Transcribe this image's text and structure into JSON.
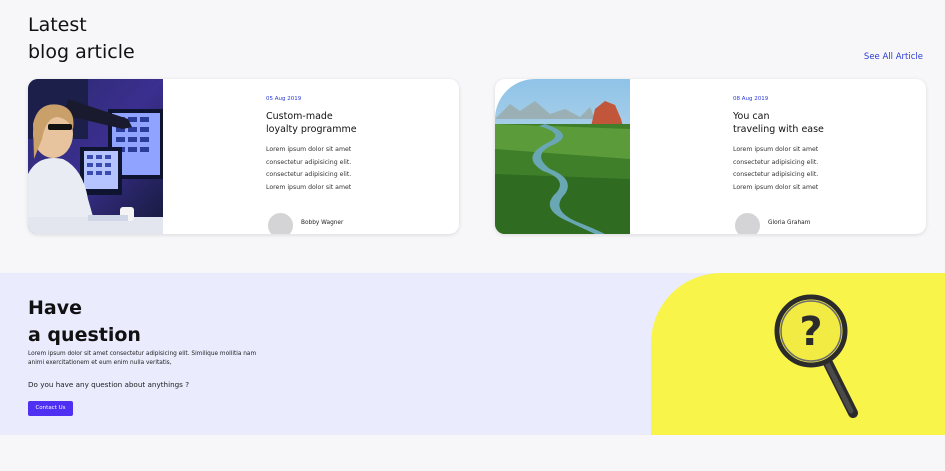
{
  "blog": {
    "heading_line1": "Latest",
    "heading_line2": "blog article",
    "see_all": "See All Article",
    "cards": [
      {
        "date": "05 Aug 2019",
        "title": "Custom-made\nloyalty programme",
        "excerpt": "Lorem ipsum dolor sit amet\nconsectetur adipisicing elit.\nconsectetur adipisicing elit.\nLorem ipsum dolor sit amet",
        "author": "Bobby Wagner",
        "image": "woman-at-computer-photo"
      },
      {
        "date": "08 Aug 2019",
        "title": "You can\ntraveling with ease",
        "excerpt": "Lorem ipsum dolor sit amet\nconsectetur adipisicing elit.\nconsectetur adipisicing elit.\nLorem ipsum dolor sit amet",
        "author": "Gloria Graham",
        "image": "river-landscape-photo"
      }
    ]
  },
  "question": {
    "heading_line1": "Have",
    "heading_line2": "a question",
    "text": "Lorem ipsum dolor sit amet consectetur adipisicing elit. Similique mollitia nam animi exercitationem et eum enim nulla veritatis,",
    "ask": "Do you have any question about anythings ?",
    "button": "Contact Us",
    "image": "magnifying-glass-question-photo",
    "image_bg": "#f8f44a"
  },
  "colors": {
    "accent": "#2a3ad6",
    "button": "#4f2ff2",
    "band": "#eaebfd"
  }
}
